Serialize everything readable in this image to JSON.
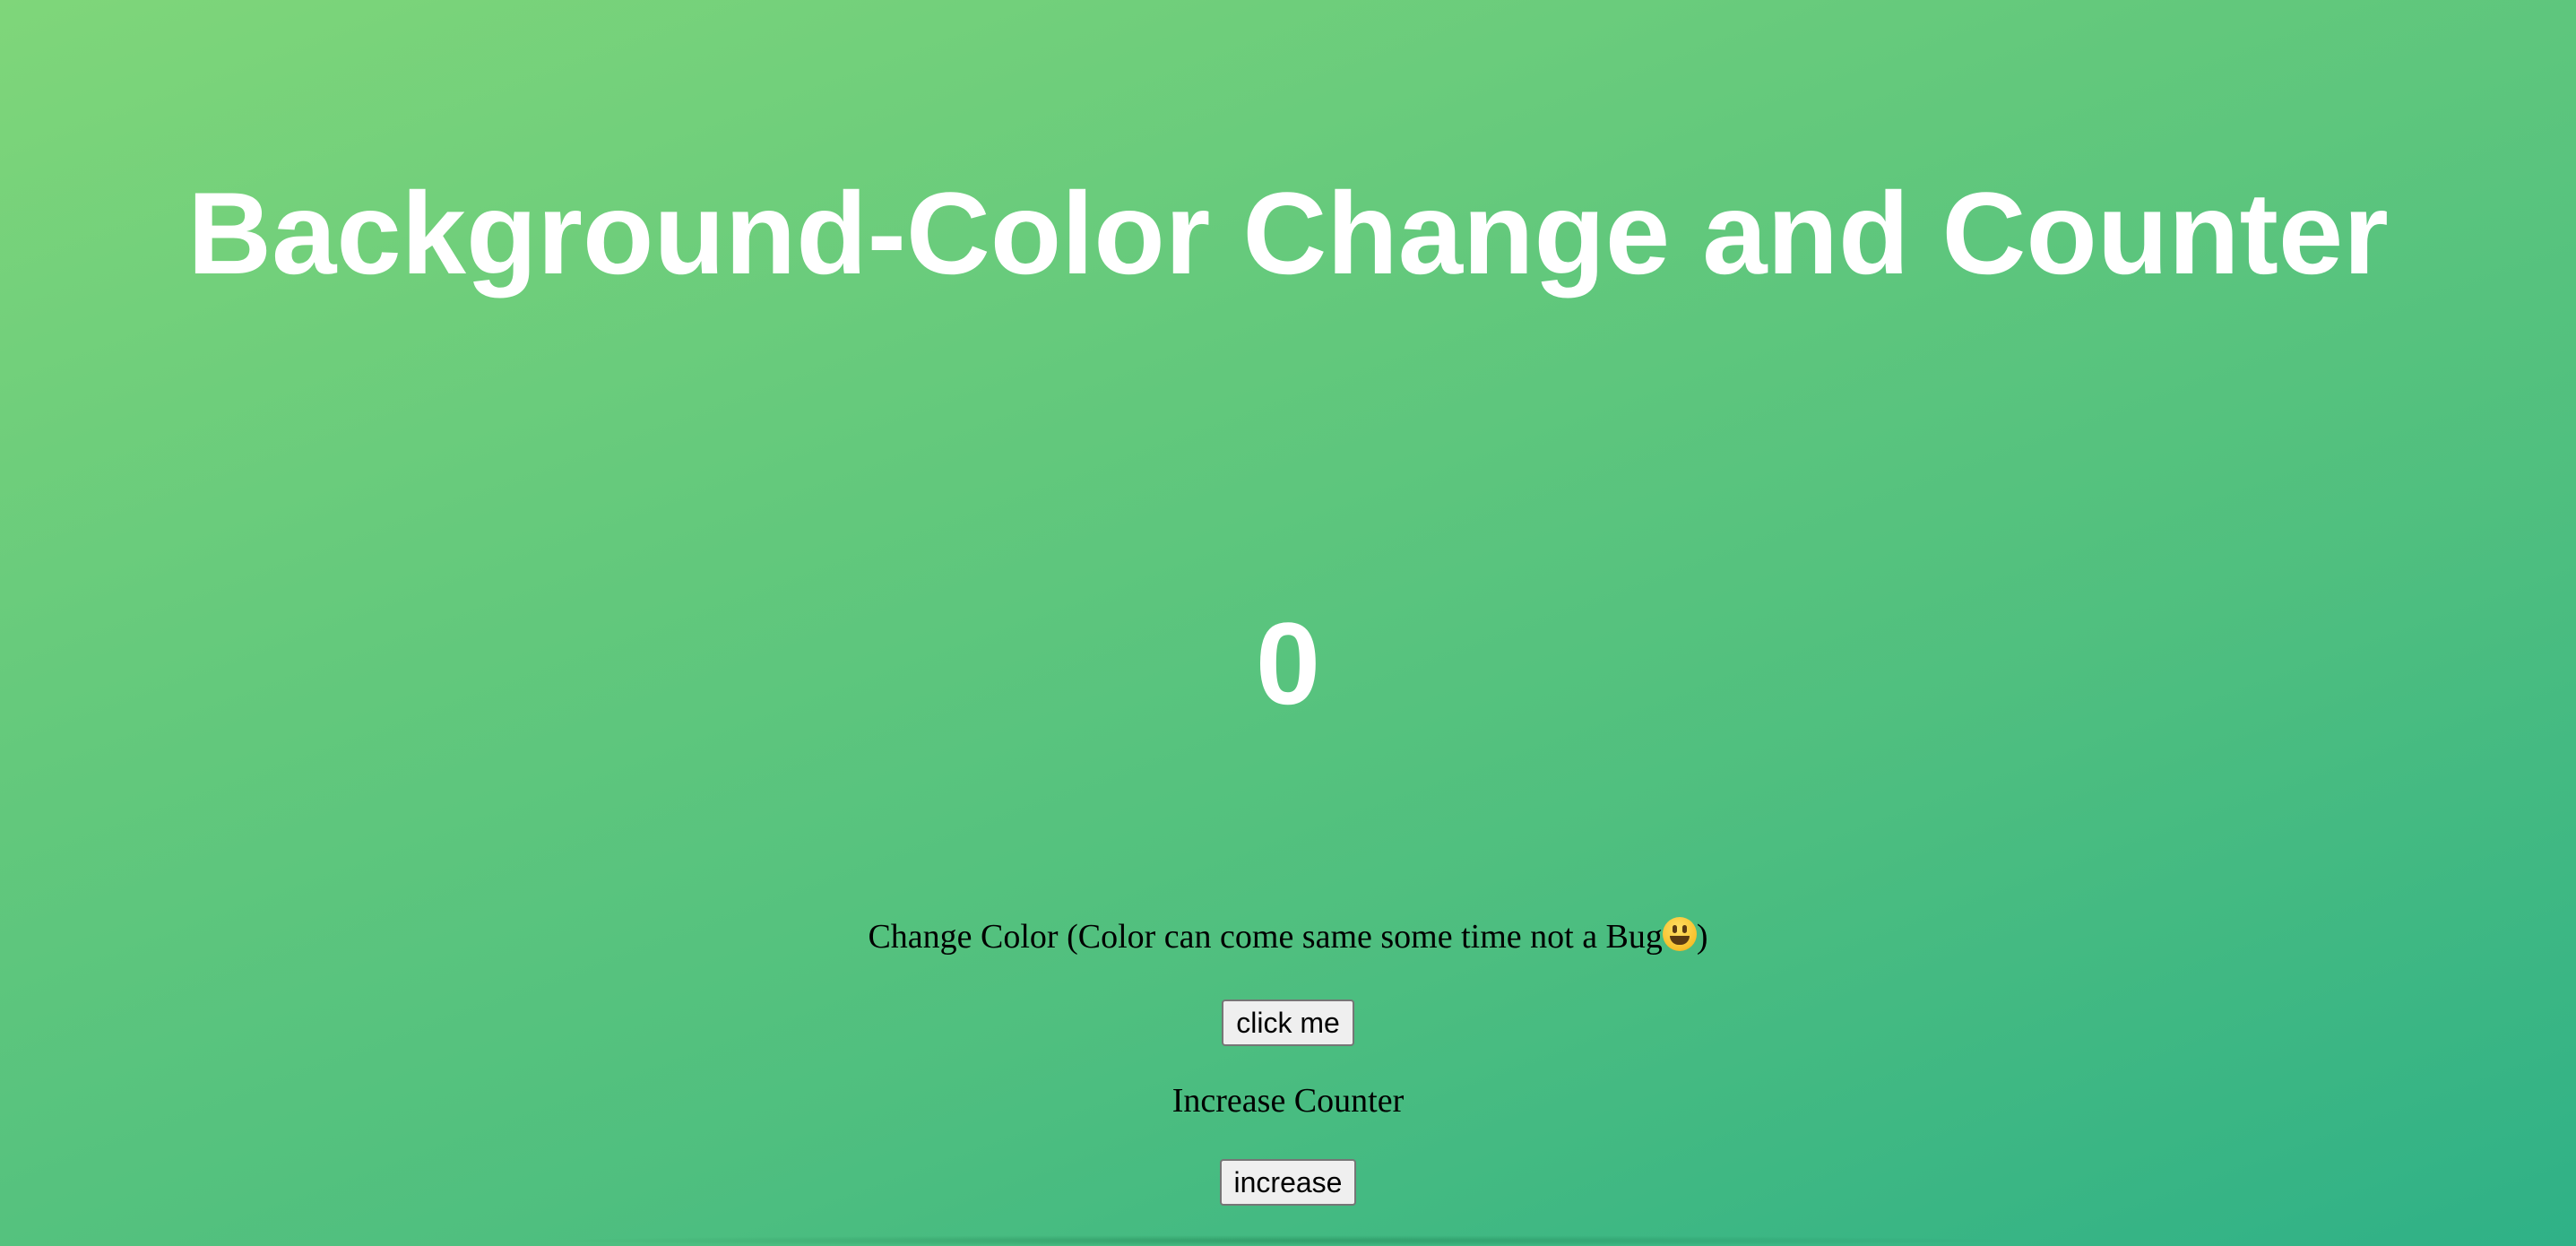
{
  "page": {
    "title": "Background-Color Change and Counter",
    "counter_value": "0",
    "background_colors": [
      "#7fd67a",
      "#2fb187"
    ]
  },
  "color_section": {
    "label": "Change Color (Color can come same some time not a Bug",
    "emoji_icon": "grinning-face-emoji",
    "label_suffix": ")",
    "button_label": "click me"
  },
  "counter_section": {
    "label": "Increase Counter",
    "button_label": "increase"
  }
}
